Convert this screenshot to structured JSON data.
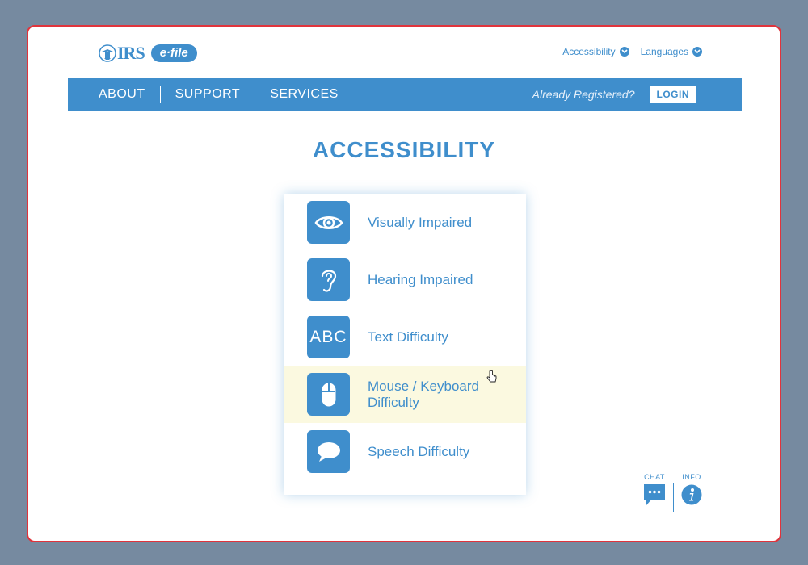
{
  "header": {
    "logo_irs": "IRS",
    "logo_efile": "e·file",
    "utility_links": [
      {
        "label": "Accessibility"
      },
      {
        "label": "Languages"
      }
    ]
  },
  "nav": {
    "items": [
      "ABOUT",
      "SUPPORT",
      "SERVICES"
    ],
    "registered_prompt": "Already Registered?",
    "login_label": "LOGIN"
  },
  "page": {
    "title": "ACCESSIBILITY"
  },
  "menu": {
    "abc_glyph": "ABC",
    "items": [
      {
        "label": "Visually Impaired",
        "icon": "eye-icon"
      },
      {
        "label": "Hearing Impaired",
        "icon": "ear-icon"
      },
      {
        "label": "Text Difficulty",
        "icon": "abc-icon"
      },
      {
        "label": "Mouse / Keyboard Difficulty",
        "icon": "mouse-icon",
        "highlighted": true
      },
      {
        "label": "Speech Difficulty",
        "icon": "speech-bubble-icon"
      }
    ]
  },
  "tools": {
    "chat_label": "CHAT",
    "info_label": "INFO"
  },
  "colors": {
    "brand_blue": "#3f8ecc",
    "frame_border": "#e0343c",
    "backdrop": "#768aa0",
    "hover_row": "#fbf9e0"
  }
}
